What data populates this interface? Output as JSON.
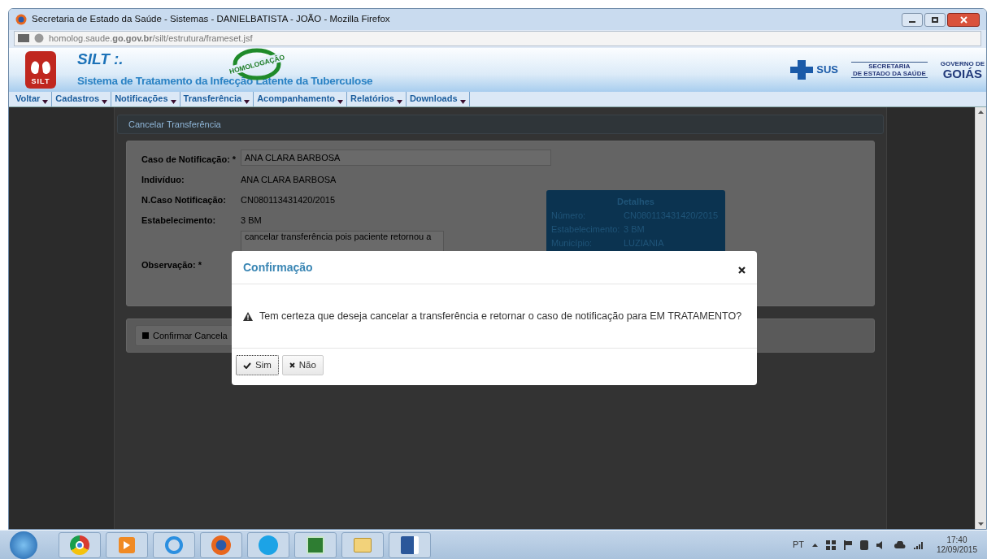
{
  "window": {
    "title": "Secretaria de Estado da Saúde - Sistemas - DANIELBATISTA - JOÃO - Mozilla Firefox"
  },
  "address_bar": {
    "url": "homolog.saude.**go.gov.br**/silt/estrutura/frameset.jsf"
  },
  "header": {
    "logo_text": "SILT",
    "app_name": "SILT :.",
    "subtitle": "Sistema de Tratamento da Infecção Latente da Tuberculose",
    "stamp": "HOMOLOGAÇÃO",
    "sus": "SUS",
    "secretaria": [
      "SECRETARIA",
      "DE ESTADO DA SAÚDE"
    ],
    "governo": [
      "GOVERNO DE",
      "GOIÁS"
    ]
  },
  "menu": [
    "Voltar",
    "Cadastros",
    "Notificações",
    "Transferência",
    "Acompanhamento",
    "Relatórios",
    "Downloads"
  ],
  "page": {
    "title": "Cancelar Transferência",
    "fields": [
      {
        "label": "Caso de Notificação: *",
        "value": "ANA CLARA BARBOSA",
        "kind": "input"
      },
      {
        "label": "Indivíduo:",
        "value": "ANA CLARA BARBOSA",
        "kind": "text"
      },
      {
        "label": "N.Caso Notificação:",
        "value": "CN080113431420/2015",
        "kind": "text"
      },
      {
        "label": "Estabelecimento:",
        "value": "3 BM",
        "kind": "text"
      },
      {
        "label": "Observação: *",
        "value": "cancelar transferência pois paciente retornou a",
        "kind": "textarea"
      }
    ],
    "details": {
      "title": "Detalhes",
      "rows": [
        {
          "label": "Número:",
          "value": "CN080113431420/2015"
        },
        {
          "label": "Estabelecimento:",
          "value": "3 BM"
        },
        {
          "label": "Município:",
          "value": "LUZIANIA"
        }
      ]
    },
    "confirm_button": "Confirmar Cancela"
  },
  "dialog": {
    "title": "Confirmação",
    "message": "Tem certeza que deseja cancelar a transferência e retornar o caso de notificação para EM TRATAMENTO?",
    "buttons": [
      {
        "label": "Sim",
        "kind": "yes"
      },
      {
        "label": "Não",
        "kind": "no"
      }
    ]
  },
  "taskbar": {
    "language": "PT",
    "time": "17:40",
    "date": "12/09/2015"
  }
}
